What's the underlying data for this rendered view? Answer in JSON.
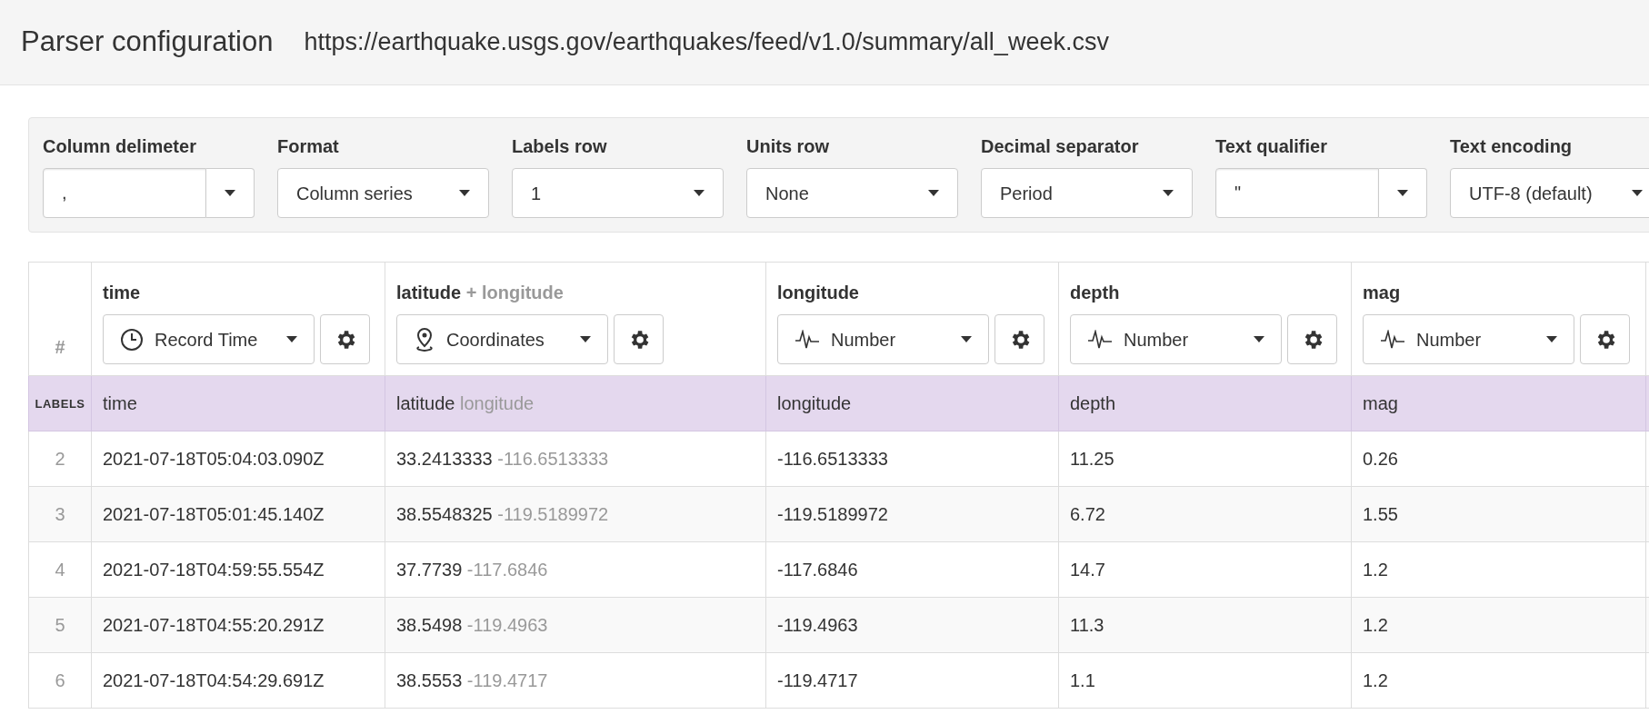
{
  "header": {
    "title": "Parser configuration",
    "url": "https://earthquake.usgs.gov/earthquakes/feed/v1.0/summary/all_week.csv"
  },
  "options": [
    {
      "label": "Column delimeter",
      "value": ",",
      "kind": "combo"
    },
    {
      "label": "Format",
      "value": "Column series",
      "kind": "select"
    },
    {
      "label": "Labels row",
      "value": "1",
      "kind": "select"
    },
    {
      "label": "Units row",
      "value": "None",
      "kind": "select"
    },
    {
      "label": "Decimal separator",
      "value": "Period",
      "kind": "select"
    },
    {
      "label": "Text qualifier",
      "value": "\"",
      "kind": "combo"
    },
    {
      "label": "Text encoding",
      "value": "UTF-8 (default)",
      "kind": "select"
    }
  ],
  "table": {
    "index_header": "#",
    "columns": [
      {
        "name": "time",
        "type": {
          "label": "Record Time",
          "kind": "time"
        }
      },
      {
        "name": "latitude",
        "secondary": "+ longitude",
        "type": {
          "label": "Coordinates",
          "kind": "coordinates"
        }
      },
      {
        "name": "longitude",
        "type": {
          "label": "Number",
          "kind": "number"
        }
      },
      {
        "name": "depth",
        "type": {
          "label": "Number",
          "kind": "number"
        }
      },
      {
        "name": "mag",
        "type": {
          "label": "Number",
          "kind": "number"
        }
      }
    ],
    "labels_row": {
      "marker": "LABELS",
      "cells": [
        {
          "text": "time"
        },
        {
          "text": "latitude",
          "secondary": "longitude"
        },
        {
          "text": "longitude"
        },
        {
          "text": "depth"
        },
        {
          "text": "mag"
        }
      ]
    },
    "rows": [
      {
        "index": "2",
        "cells": [
          {
            "text": "2021-07-18T05:04:03.090Z"
          },
          {
            "text": "33.2413333",
            "secondary": "-116.6513333"
          },
          {
            "text": "-116.6513333"
          },
          {
            "text": "11.25"
          },
          {
            "text": "0.26"
          }
        ]
      },
      {
        "index": "3",
        "cells": [
          {
            "text": "2021-07-18T05:01:45.140Z"
          },
          {
            "text": "38.5548325",
            "secondary": "-119.5189972"
          },
          {
            "text": "-119.5189972"
          },
          {
            "text": "6.72"
          },
          {
            "text": "1.55"
          }
        ]
      },
      {
        "index": "4",
        "cells": [
          {
            "text": "2021-07-18T04:59:55.554Z"
          },
          {
            "text": "37.7739",
            "secondary": "-117.6846"
          },
          {
            "text": "-117.6846"
          },
          {
            "text": "14.7"
          },
          {
            "text": "1.2"
          }
        ]
      },
      {
        "index": "5",
        "cells": [
          {
            "text": "2021-07-18T04:55:20.291Z"
          },
          {
            "text": "38.5498",
            "secondary": "-119.4963"
          },
          {
            "text": "-119.4963"
          },
          {
            "text": "11.3"
          },
          {
            "text": "1.2"
          }
        ]
      },
      {
        "index": "6",
        "cells": [
          {
            "text": "2021-07-18T04:54:29.691Z"
          },
          {
            "text": "38.5553",
            "secondary": "-119.4717"
          },
          {
            "text": "-119.4717"
          },
          {
            "text": "1.1"
          },
          {
            "text": "1.2"
          }
        ]
      }
    ]
  }
}
